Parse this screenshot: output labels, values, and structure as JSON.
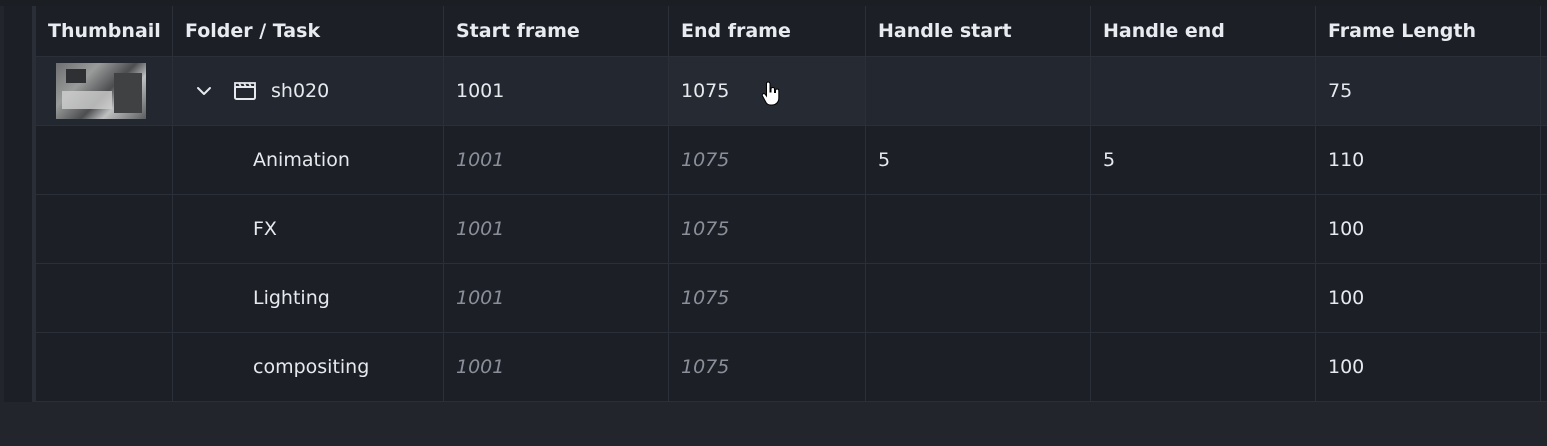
{
  "columns": [
    "Thumbnail",
    "Folder / Task",
    "Start frame",
    "End frame",
    "Handle start",
    "Handle end",
    "Frame Length"
  ],
  "folder": {
    "name": "sh020",
    "start": "1001",
    "end": "1075",
    "handle_start": "",
    "handle_end": "",
    "length": "75",
    "icons": {
      "expand": "chevron-down-icon",
      "type": "clapperboard-icon"
    }
  },
  "tasks": [
    {
      "name": "Animation",
      "start": "1001",
      "end": "1075",
      "handle_start": "5",
      "handle_end": "5",
      "length": "110"
    },
    {
      "name": "FX",
      "start": "1001",
      "end": "1075",
      "handle_start": "",
      "handle_end": "",
      "length": "100"
    },
    {
      "name": "Lighting",
      "start": "1001",
      "end": "1075",
      "handle_start": "",
      "handle_end": "",
      "length": "100"
    },
    {
      "name": "compositing",
      "start": "1001",
      "end": "1075",
      "handle_start": "",
      "handle_end": "",
      "length": "100"
    }
  ],
  "colors": {
    "background": "#1c1f26",
    "selected_row": "#232830",
    "inherited_text": "#8a8f99"
  }
}
